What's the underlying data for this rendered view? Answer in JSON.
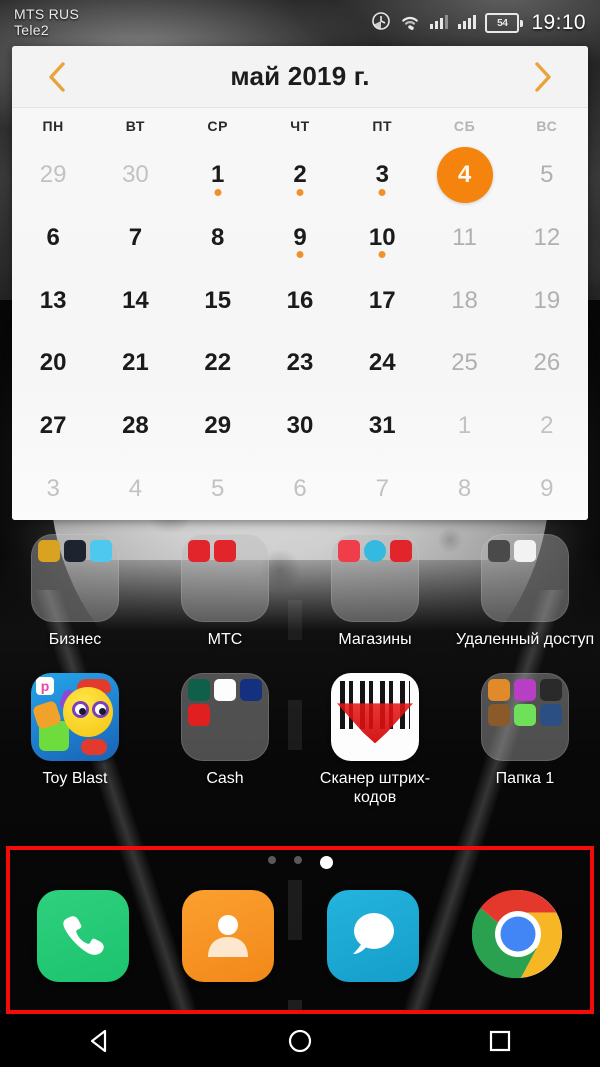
{
  "status_bar": {
    "carrier_primary": "MTS RUS",
    "carrier_secondary": "Tele2",
    "icons": [
      "alarm-icon",
      "wifi-icon",
      "signal-sim1-icon",
      "signal-sim2-icon"
    ],
    "battery_level": "54",
    "time": "19:10"
  },
  "calendar": {
    "title": "май 2019 г.",
    "prev_label": "‹",
    "next_label": "›",
    "accent_color": "#f4840d",
    "weekdays": [
      "ПН",
      "ВТ",
      "СР",
      "ЧТ",
      "ПТ",
      "СБ",
      "ВС"
    ],
    "weekend_indices": [
      5,
      6
    ],
    "selected_day": "4",
    "days": [
      {
        "n": "29",
        "type": "muted"
      },
      {
        "n": "30",
        "type": "muted"
      },
      {
        "n": "1",
        "type": "current",
        "dot": true
      },
      {
        "n": "2",
        "type": "current",
        "dot": true
      },
      {
        "n": "3",
        "type": "current",
        "dot": true
      },
      {
        "n": "4",
        "type": "selected"
      },
      {
        "n": "5",
        "type": "weekend"
      },
      {
        "n": "6",
        "type": "current"
      },
      {
        "n": "7",
        "type": "current"
      },
      {
        "n": "8",
        "type": "current"
      },
      {
        "n": "9",
        "type": "current",
        "dot": true
      },
      {
        "n": "10",
        "type": "current",
        "dot": true
      },
      {
        "n": "11",
        "type": "weekend"
      },
      {
        "n": "12",
        "type": "weekend"
      },
      {
        "n": "13",
        "type": "current"
      },
      {
        "n": "14",
        "type": "current"
      },
      {
        "n": "15",
        "type": "current"
      },
      {
        "n": "16",
        "type": "current"
      },
      {
        "n": "17",
        "type": "current"
      },
      {
        "n": "18",
        "type": "weekend"
      },
      {
        "n": "19",
        "type": "weekend"
      },
      {
        "n": "20",
        "type": "current"
      },
      {
        "n": "21",
        "type": "current"
      },
      {
        "n": "22",
        "type": "current"
      },
      {
        "n": "23",
        "type": "current"
      },
      {
        "n": "24",
        "type": "current"
      },
      {
        "n": "25",
        "type": "weekend"
      },
      {
        "n": "26",
        "type": "weekend"
      },
      {
        "n": "27",
        "type": "current"
      },
      {
        "n": "28",
        "type": "current"
      },
      {
        "n": "29",
        "type": "current"
      },
      {
        "n": "30",
        "type": "current"
      },
      {
        "n": "31",
        "type": "current"
      },
      {
        "n": "1",
        "type": "muted"
      },
      {
        "n": "2",
        "type": "muted"
      },
      {
        "n": "3",
        "type": "muted"
      },
      {
        "n": "4",
        "type": "muted"
      },
      {
        "n": "5",
        "type": "muted"
      },
      {
        "n": "6",
        "type": "muted"
      },
      {
        "n": "7",
        "type": "muted"
      },
      {
        "n": "8",
        "type": "muted"
      },
      {
        "n": "9",
        "type": "muted"
      }
    ]
  },
  "home": {
    "row1": [
      {
        "label": "Бизнес",
        "kind": "folder",
        "icon_colors": [
          "#d9a321",
          "#1d2430",
          "#4ec8ef"
        ]
      },
      {
        "label": "МТС",
        "kind": "folder",
        "icon_colors": [
          "#e1252b",
          "#e1252b"
        ]
      },
      {
        "label": "Магазины",
        "kind": "folder",
        "icon_colors": [
          "#ef3d4a",
          "#34b9e0",
          "#e1252b"
        ]
      },
      {
        "label": "Удаленный доступ",
        "kind": "folder",
        "icon_colors": [
          "#4a4a4a",
          "#f2f2f2"
        ]
      }
    ],
    "row2": [
      {
        "label": "Toy Blast",
        "kind": "app",
        "icon": "toy-blast-icon"
      },
      {
        "label": "Cash",
        "kind": "folder",
        "icon_colors": [
          "#0f5f4a",
          "#fdfdfd",
          "#14307f",
          "#e02020"
        ]
      },
      {
        "label": "Сканер штрих-кодов",
        "kind": "app",
        "icon": "barcode-scanner-icon"
      },
      {
        "label": "Папка 1",
        "kind": "folder",
        "icon_colors": [
          "#e08a2a",
          "#b83ec4",
          "#2a2a2a",
          "#8a5a2a",
          "#6fe05a",
          "#2b4f82"
        ]
      }
    ]
  },
  "dock": {
    "highlight_color": "#f40c0c",
    "items": [
      {
        "name": "phone",
        "icon": "phone-icon",
        "color": "#1cc36d"
      },
      {
        "name": "contacts",
        "icon": "contacts-icon",
        "color": "#f2881a"
      },
      {
        "name": "messages",
        "icon": "message-bubble-icon",
        "color": "#149ec9"
      },
      {
        "name": "chrome",
        "icon": "chrome-icon",
        "color": "#4285f4"
      }
    ]
  },
  "page_indicator": {
    "total": 3,
    "active": 3
  },
  "navbar": {
    "back": "back-icon",
    "home": "home-icon",
    "recents": "recents-icon"
  }
}
